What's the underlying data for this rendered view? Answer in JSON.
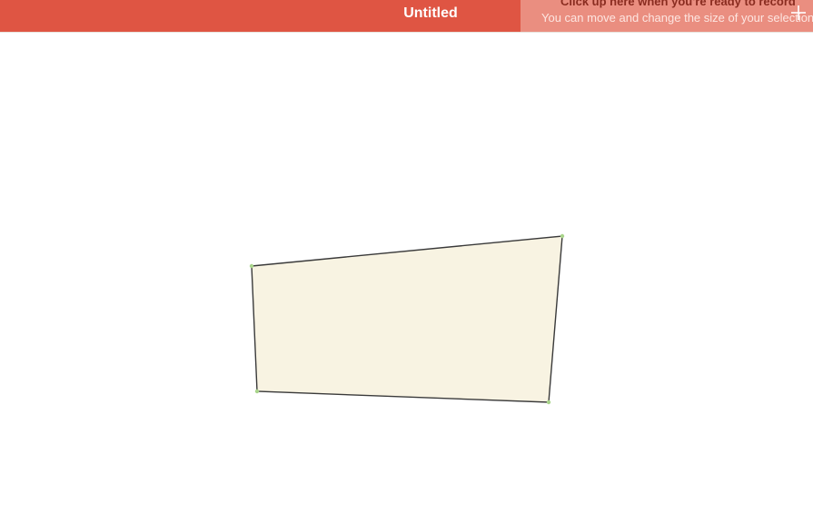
{
  "window": {
    "title": "Untitled"
  },
  "hint": {
    "main_text": "Click up here when you're ready to record",
    "sub_text": "You can move and change the size of your selection"
  },
  "icons": {
    "add": "plus-icon"
  },
  "colors": {
    "titlebar": "#df5543",
    "hint_panel": "#ea8e80",
    "selection_fill": "#f8f3e2",
    "selection_stroke": "#3a3a3a",
    "handle": "#a8d48a"
  }
}
